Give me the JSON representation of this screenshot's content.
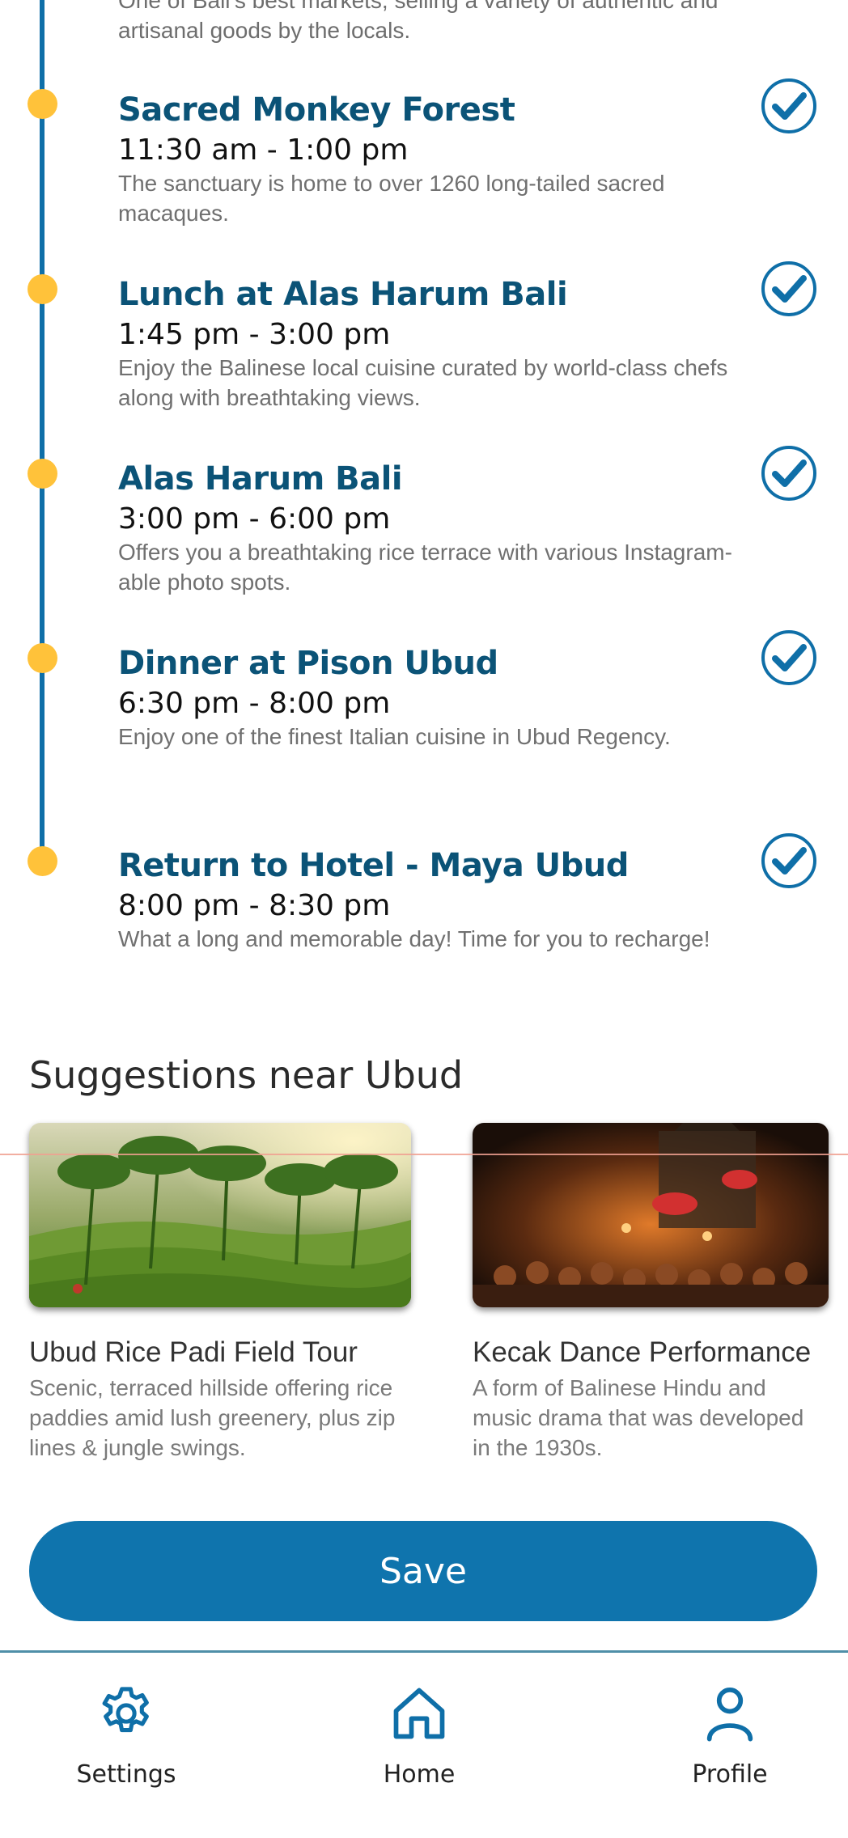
{
  "timeline": {
    "previous_description": "One of Bali's best markets, selling a variety of authentic and artisanal goods by the locals.",
    "items": [
      {
        "title": "Sacred Monkey Forest",
        "time": "11:30 am - 1:00 pm",
        "description": "The sanctuary is home to over 1260 long-tailed sacred macaques.",
        "checked": true
      },
      {
        "title": "Lunch at Alas Harum Bali",
        "time": "1:45 pm - 3:00 pm",
        "description": "Enjoy the Balinese local cuisine curated by world-class chefs along with breathtaking views.",
        "checked": true
      },
      {
        "title": "Alas Harum Bali",
        "time": "3:00 pm - 6:00 pm",
        "description": "Offers you a breathtaking rice terrace with various Instagram-able photo spots.",
        "checked": true
      },
      {
        "title": "Dinner at Pison Ubud",
        "time": "6:30 pm - 8:00 pm",
        "description": "Enjoy one of the finest Italian cuisine in Ubud Regency.",
        "checked": true
      },
      {
        "title": "Return to Hotel - Maya Ubud",
        "time": "8:00 pm - 8:30 pm",
        "description": "What a long and memorable day! Time for you to recharge!",
        "checked": true
      }
    ]
  },
  "suggestions": {
    "title": "Suggestions near Ubud",
    "cards": [
      {
        "title": "Ubud Rice Padi Field Tour",
        "description": "Scenic, terraced hillside offering rice paddies amid lush greenery, plus zip lines & jungle swings.",
        "image": "rice-terrace-photo"
      },
      {
        "title": "Kecak Dance Performance",
        "description": "A form of Balinese Hindu and music drama that was developed in the 1930s.",
        "image": "kecak-dance-photo"
      }
    ]
  },
  "save_label": "Save",
  "nav": {
    "settings": {
      "label": "Settings",
      "icon": "gear-icon"
    },
    "home": {
      "label": "Home",
      "icon": "home-icon"
    },
    "profile": {
      "label": "Profile",
      "icon": "user-icon"
    }
  },
  "colors": {
    "accent": "#0f74ad",
    "title": "#0b5377",
    "timeline_dot": "#ffc23a"
  }
}
